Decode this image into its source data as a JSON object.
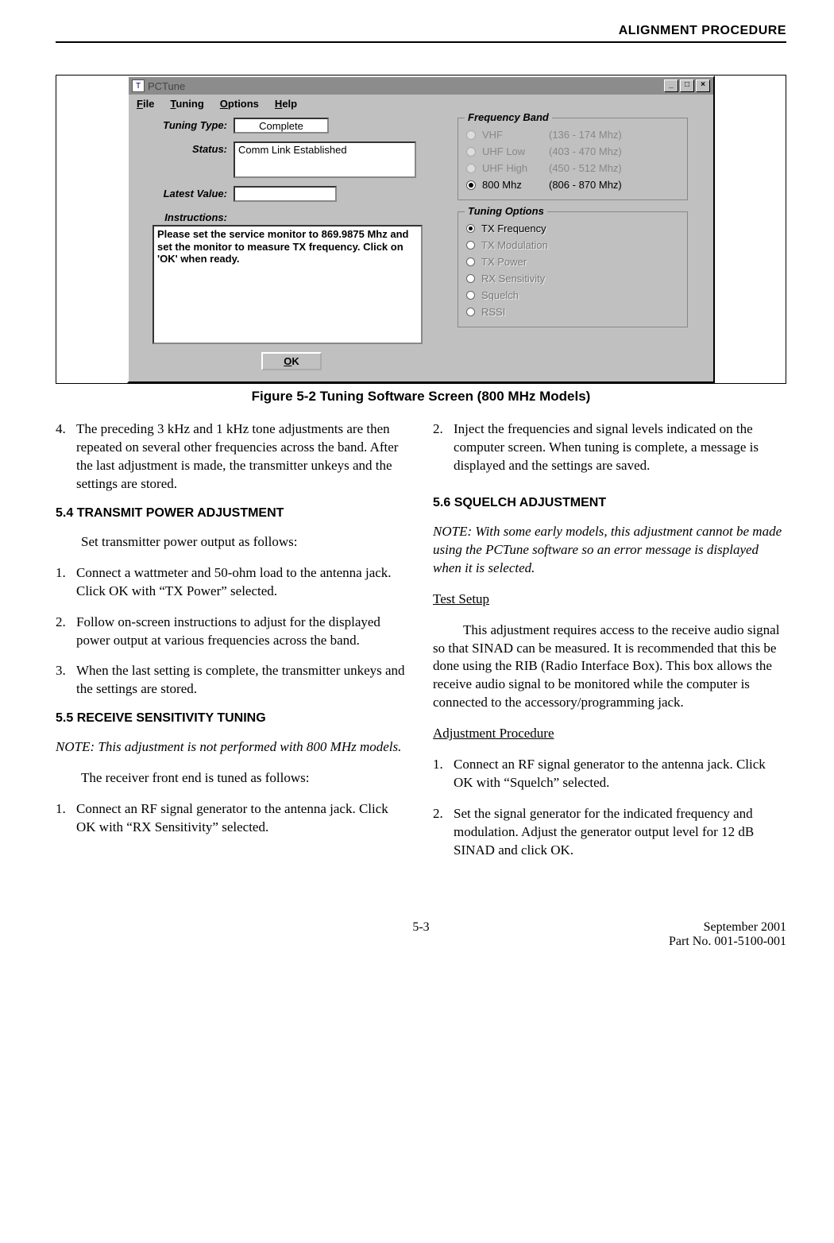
{
  "page_header": "ALIGNMENT PROCEDURE",
  "figure": {
    "window_title": "PCTune",
    "menu": {
      "file": "File",
      "tuning": "Tuning",
      "options": "Options",
      "help": "Help"
    },
    "labels": {
      "tuning_type": "Tuning Type:",
      "status": "Status:",
      "latest_value": "Latest Value:",
      "instructions": "Instructions:"
    },
    "tuning_type_value": "Complete",
    "status_value": "Comm Link Established",
    "latest_value_value": "",
    "instructions_value": "Please set the service monitor to  869.9875 Mhz and set the monitor to measure TX frequency. Click on 'OK' when ready.",
    "ok_label": "OK",
    "freq_band": {
      "title": "Frequency Band",
      "items": [
        {
          "name": "VHF",
          "range": "(136 - 174 Mhz)",
          "selected": false,
          "disabled": true
        },
        {
          "name": "UHF Low",
          "range": "(403 - 470 Mhz)",
          "selected": false,
          "disabled": true
        },
        {
          "name": "UHF High",
          "range": "(450 - 512 Mhz)",
          "selected": false,
          "disabled": true
        },
        {
          "name": "800 Mhz",
          "range": "(806 - 870 Mhz)",
          "selected": true,
          "disabled": false
        }
      ]
    },
    "tuning_options": {
      "title": "Tuning Options",
      "items": [
        {
          "label": "TX Frequency",
          "selected": true
        },
        {
          "label": "TX Modulation",
          "selected": false
        },
        {
          "label": "TX Power",
          "selected": false
        },
        {
          "label": "RX Sensitivity",
          "selected": false
        },
        {
          "label": "Squelch",
          "selected": false
        },
        {
          "label": "RSSI",
          "selected": false
        }
      ]
    }
  },
  "caption": "Figure 5-2   Tuning Software Screen (800 MHz Models)",
  "left_col": {
    "item4": "The preceding 3 kHz and 1 kHz tone adjustments are then repeated on several other frequencies across the band. After the last adjustment is made, the transmitter unkeys and the settings are stored.",
    "h54": "5.4 TRANSMIT POWER ADJUSTMENT",
    "p54_intro": "Set transmitter power output as follows:",
    "i54_1": "Connect a wattmeter and 50-ohm load to the antenna jack. Click OK with “TX Power” selected.",
    "i54_2": "Follow on-screen instructions to adjust for the displayed power output at various frequencies across the band.",
    "i54_3": "When the last setting is complete, the transmitter unkeys and the settings are stored.",
    "h55": "5.5 RECEIVE SENSITIVITY TUNING",
    "note55": "NOTE: This adjustment is not performed with 800 MHz models.",
    "p55_intro": "The receiver front end is tuned as follows:",
    "i55_1": "Connect an RF signal generator to the antenna jack. Click OK with “RX Sensitivity” selected."
  },
  "right_col": {
    "i55_2": "Inject the frequencies and signal levels indicated on the computer screen. When tuning is complete, a message is displayed and the settings are saved.",
    "h56": "5.6 SQUELCH ADJUSTMENT",
    "note56": "NOTE: With some early models, this adjustment cannot be made using the PCTune software so an error message is displayed when it is selected.",
    "sub_test": "Test Setup",
    "p_test": "This adjustment requires access to the receive audio signal so that SINAD can be measured. It is recommended that this be done using the RIB (Radio Interface Box). This box allows the receive audio signal to be monitored while the computer is connected to the accessory/programming jack.",
    "sub_adj": "Adjustment Procedure",
    "i56_1": "Connect an RF signal generator to the antenna jack. Click OK with “Squelch” selected.",
    "i56_2": "Set the signal generator for the indicated frequency and modulation. Adjust the generator output level for 12 dB SINAD and click OK."
  },
  "footer": {
    "page": "5-3",
    "date": "September 2001",
    "part": "Part No. 001-5100-001"
  }
}
